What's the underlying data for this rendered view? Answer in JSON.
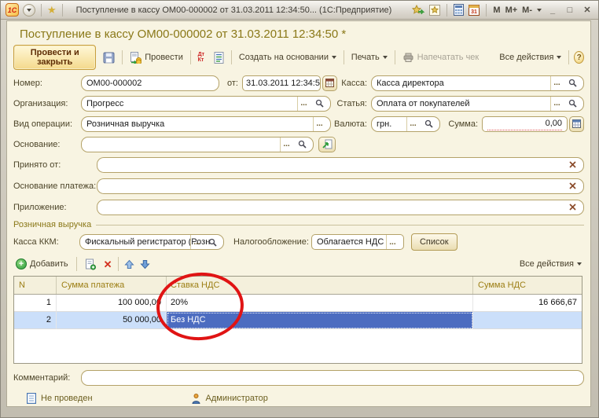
{
  "titlebar": {
    "title": "Поступление в кассу ОМ00-000002 от 31.03.2011 12:34:50...  (1С:Предприятие)",
    "logo": "1С",
    "mem": [
      "M",
      "M+",
      "M-"
    ],
    "minimize": "_",
    "maximize": "□",
    "close": "✕"
  },
  "page": {
    "title": "Поступление в кассу ОМ00-000002 от 31.03.2011 12:34:50 *"
  },
  "toolbar": {
    "post_and_close": "Провести и закрыть",
    "post": "Провести",
    "dtkt_top": "Дт",
    "dtkt_bottom": "Кт",
    "create_based_on": "Создать на основании",
    "print": "Печать",
    "print_receipt": "Напечатать чек",
    "all_actions": "Все действия",
    "help": "?"
  },
  "fields": {
    "number": {
      "label": "Номер:",
      "value": "ОМ00-000002"
    },
    "date": {
      "label": "от:",
      "value": "31.03.2011 12:34:50"
    },
    "organization": {
      "label": "Организация:",
      "value": "Прогресс"
    },
    "operation_kind": {
      "label": "Вид операции:",
      "value": "Розничная выручка"
    },
    "basis": {
      "label": "Основание:",
      "value": ""
    },
    "cash_desk": {
      "label": "Касса:",
      "value": "Касса директора"
    },
    "item": {
      "label": "Статья:",
      "value": "Оплата от покупателей"
    },
    "currency": {
      "label": "Валюта:",
      "value": "грн."
    },
    "amount": {
      "label": "Сумма:",
      "value": "0,00"
    },
    "accepted_from": {
      "label": "Принято от:",
      "value": ""
    },
    "payment_basis": {
      "label": "Основание платежа:",
      "value": ""
    },
    "appendix": {
      "label": "Приложение:",
      "value": ""
    },
    "comment": {
      "label": "Комментарий:",
      "value": ""
    }
  },
  "retail_group": {
    "caption": "Розничная выручка",
    "kkm": {
      "label": "Касса ККМ:",
      "value": "Фискальный регистратор (Розн"
    },
    "taxation": {
      "label": "Налогообложение:",
      "value": "Облагается НДС"
    },
    "list_button": "Список"
  },
  "grid_toolbar": {
    "add": "Добавить",
    "all_actions": "Все действия"
  },
  "grid": {
    "columns": [
      "N",
      "Сумма платежа",
      "Ставка НДС",
      "Сумма НДС"
    ],
    "rows": [
      {
        "n": "1",
        "payment": "100 000,00",
        "vat_rate": "20%",
        "vat_sum": "16 666,67"
      },
      {
        "n": "2",
        "payment": "50 000,00",
        "vat_rate": "Без НДС",
        "vat_sum": ""
      }
    ]
  },
  "status": {
    "posted": "Не проведен",
    "user": "Администратор"
  },
  "ui": {
    "ellipsis": "..."
  }
}
